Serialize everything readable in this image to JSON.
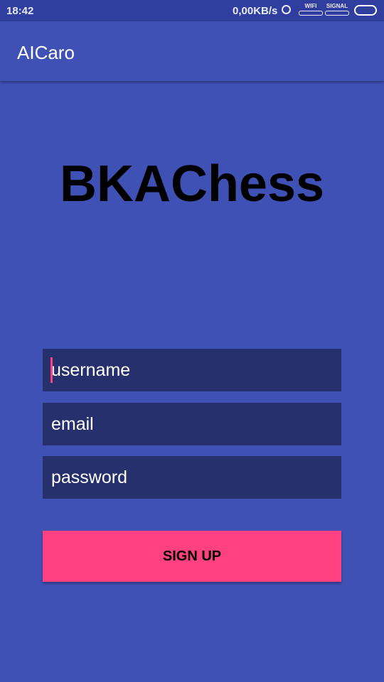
{
  "status": {
    "time": "18:42",
    "speed": "0,00KB/s",
    "wifi": "WIFI",
    "signal": "SIGNAL"
  },
  "appbar": {
    "title": "AICaro"
  },
  "logo": "BKAChess",
  "form": {
    "username_placeholder": "username",
    "email_placeholder": "email",
    "password_placeholder": "password",
    "signup_label": "SIGN UP"
  }
}
